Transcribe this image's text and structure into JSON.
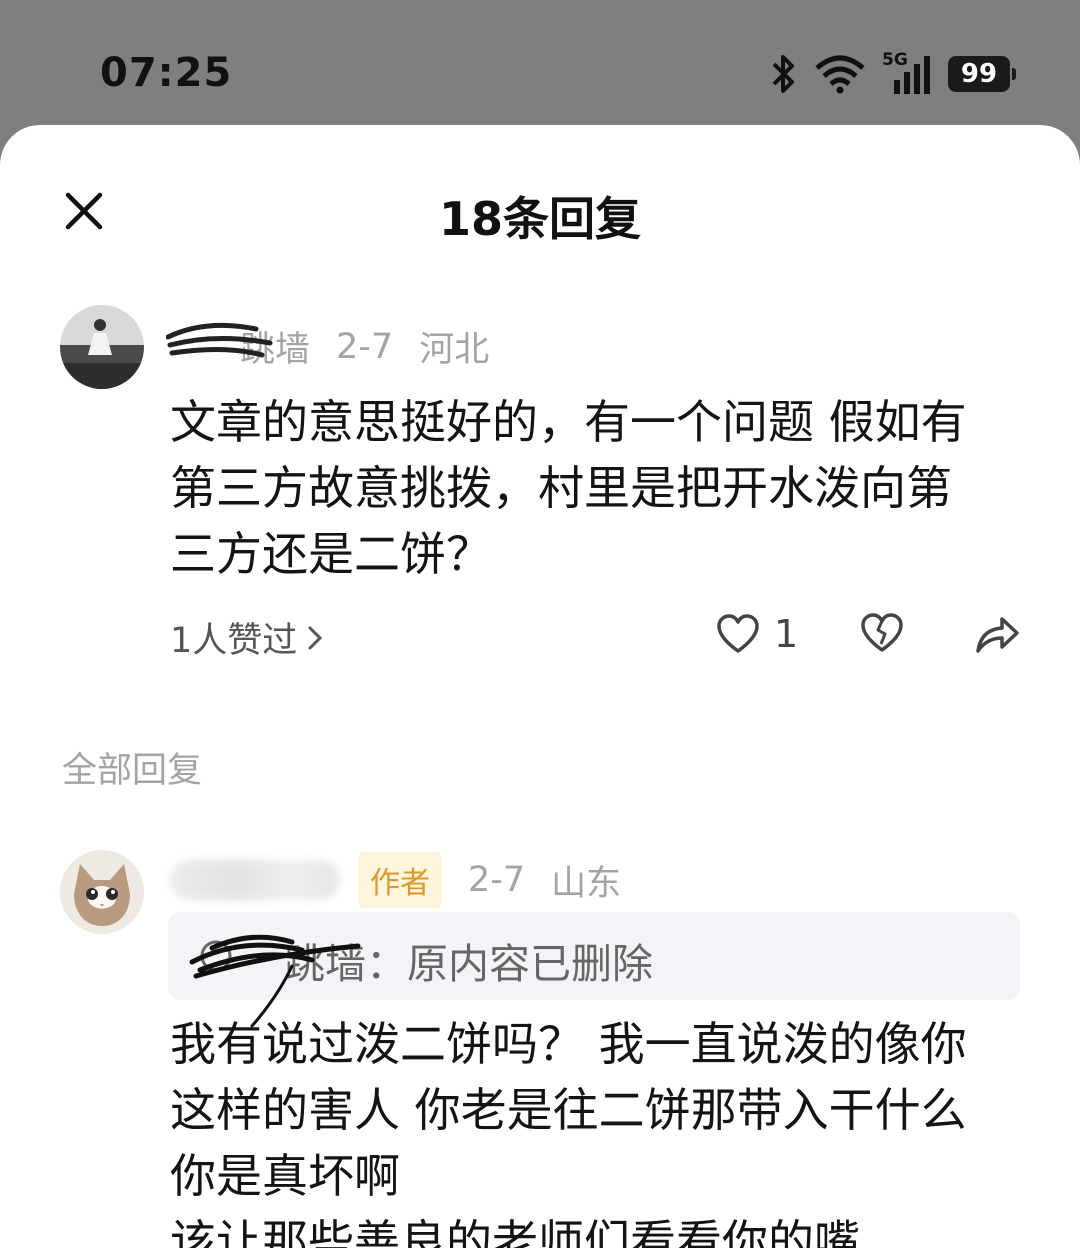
{
  "status_bar": {
    "time": "07:25",
    "battery": "99",
    "network": "5G",
    "icons": [
      "bluetooth-icon",
      "wifi-icon",
      "signal-icon",
      "battery-icon"
    ]
  },
  "sheet": {
    "title": "18条回复",
    "close_icon": "close-icon"
  },
  "main_comment": {
    "username": "跳墙",
    "date": "2-7",
    "location": "河北",
    "text_lines": [
      "文章的意思挺好的，有一个问题 假如有",
      "第三方故意挑拨，村里是把开水泼向第",
      "三方还是二饼？"
    ],
    "likes_link": "1人赞过",
    "like_count": "1"
  },
  "all_replies": {
    "title": "全部回复"
  },
  "reply": {
    "badge": "作者",
    "date": "2-7",
    "location": "山东",
    "quote": "跳墙：原内容已删除",
    "text_lines": [
      "我有说过泼二饼吗？ 我一直说泼的像你",
      "这样的害人 你老是往二饼那带入干什么",
      "你是真坏啊",
      "该让那些善良的老师们看看你的嘴"
    ]
  },
  "colors": {
    "accent_badge_bg": "#fff4dc",
    "accent_badge_text": "#d99a2b",
    "meta_gray": "#a4a4a4"
  }
}
